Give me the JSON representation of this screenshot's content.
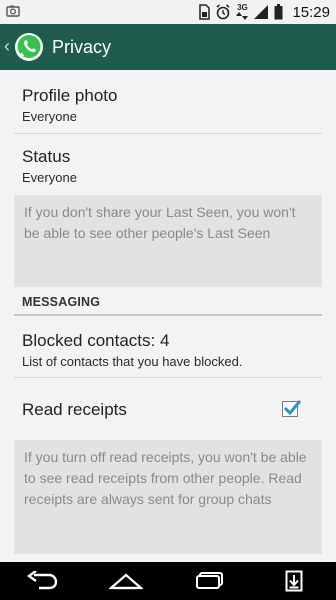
{
  "status_bar": {
    "network_label": "3G",
    "time": "15:29"
  },
  "header": {
    "title": "Privacy",
    "brand_color": "#1f5c4e"
  },
  "privacy": {
    "profile_photo": {
      "title": "Profile photo",
      "value": "Everyone"
    },
    "status": {
      "title": "Status",
      "value": "Everyone"
    },
    "last_seen_note": "If you don't share your Last Seen, you won't be able to see other people's Last Seen"
  },
  "messaging": {
    "header": "MESSAGING",
    "blocked_contacts": {
      "title": "Blocked contacts: 4",
      "summary": "List of contacts that you have blocked."
    },
    "read_receipts": {
      "title": "Read receipts",
      "checked": true
    },
    "read_receipts_note": "If you turn off read receipts, you won't be able to see read receipts from other people. Read receipts are always sent for group chats"
  },
  "icons": {
    "status_left": "screenshot-icon",
    "status_right": [
      "sim-icon",
      "alarm-icon",
      "3g-data-icon",
      "signal-icon",
      "battery-icon"
    ],
    "nav": [
      "back-icon",
      "home-icon",
      "recent-apps-icon",
      "download-icon"
    ]
  }
}
